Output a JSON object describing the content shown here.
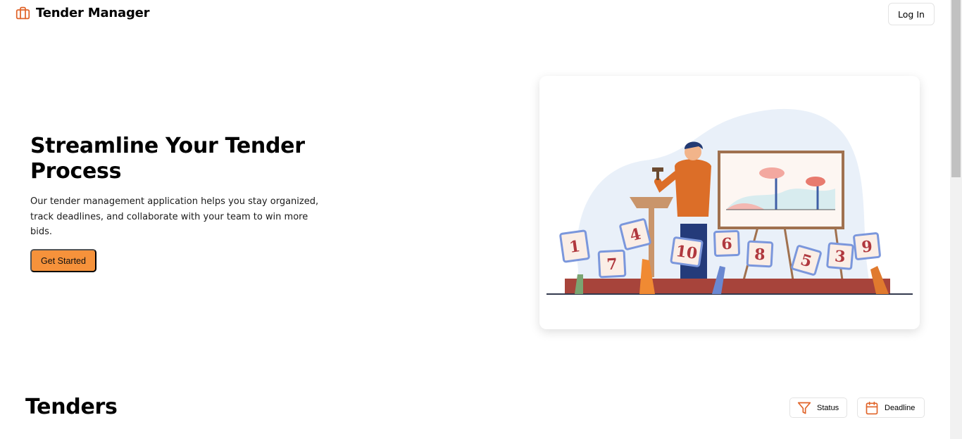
{
  "header": {
    "app_title": "Tender Manager",
    "login_label": "Log In"
  },
  "hero": {
    "title": "Streamline Your Tender Process",
    "description": "Our tender management application helps you stay organized, track deadlines, and collaborate with your team to win more bids.",
    "cta_label": "Get Started",
    "illustration_sign_numbers": [
      "1",
      "7",
      "4",
      "10",
      "6",
      "8",
      "5",
      "3",
      "9"
    ]
  },
  "tenders": {
    "section_title": "Tenders",
    "filters": [
      {
        "label": "Status",
        "icon": "filter-icon"
      },
      {
        "label": "Deadline",
        "icon": "calendar-icon"
      }
    ]
  },
  "colors": {
    "brand": "#e0642a",
    "cta": "#f6923b",
    "stage": "#a7443b"
  }
}
